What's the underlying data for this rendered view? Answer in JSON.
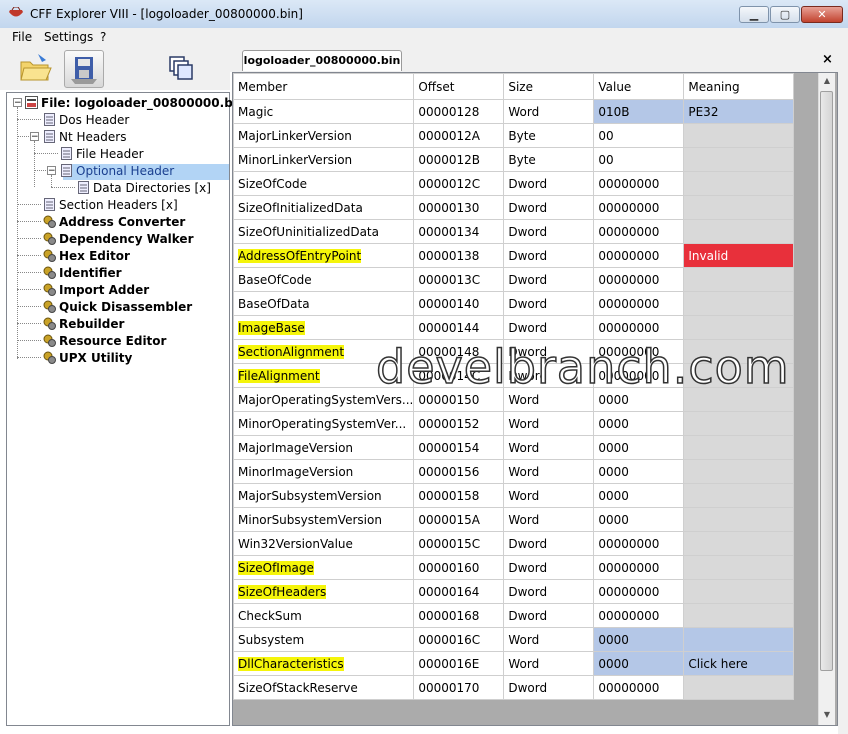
{
  "window": {
    "title": "CFF Explorer VIII - [logoloader_00800000.bin]",
    "min_icon": "minimize-icon",
    "max_icon": "maximize-icon",
    "close_icon": "close-icon",
    "min_glyph": "▁",
    "max_glyph": "▢",
    "close_glyph": "✕"
  },
  "menu": {
    "file": "File",
    "settings": "Settings",
    "help": "?"
  },
  "tree": {
    "root": "File: logoloader_00800000.bin",
    "dos_header": "Dos Header",
    "nt_headers": "Nt Headers",
    "file_header": "File Header",
    "optional_header": "Optional Header",
    "data_directories": "Data Directories [x]",
    "section_headers": "Section Headers [x]",
    "tools": [
      "Address Converter",
      "Dependency Walker",
      "Hex Editor",
      "Identifier",
      "Import Adder",
      "Quick Disassembler",
      "Rebuilder",
      "Resource Editor",
      "UPX Utility"
    ]
  },
  "tab": {
    "label": "logoloader_00800000.bin",
    "close": "×"
  },
  "grid": {
    "columns": [
      "Member",
      "Offset",
      "Size",
      "Value",
      "Meaning"
    ],
    "rows": [
      {
        "member": "Magic",
        "offset": "00000128",
        "size": "Word",
        "value": "010B",
        "meaning": "PE32",
        "style": "blue"
      },
      {
        "member": "MajorLinkerVersion",
        "offset": "0000012A",
        "size": "Byte",
        "value": "00",
        "meaning": ""
      },
      {
        "member": "MinorLinkerVersion",
        "offset": "0000012B",
        "size": "Byte",
        "value": "00",
        "meaning": ""
      },
      {
        "member": "SizeOfCode",
        "offset": "0000012C",
        "size": "Dword",
        "value": "00000000",
        "meaning": ""
      },
      {
        "member": "SizeOfInitializedData",
        "offset": "00000130",
        "size": "Dword",
        "value": "00000000",
        "meaning": ""
      },
      {
        "member": "SizeOfUninitializedData",
        "offset": "00000134",
        "size": "Dword",
        "value": "00000000",
        "meaning": ""
      },
      {
        "member": "AddressOfEntryPoint",
        "offset": "00000138",
        "size": "Dword",
        "value": "00000000",
        "meaning": "Invalid",
        "style": "red",
        "hl": true
      },
      {
        "member": "BaseOfCode",
        "offset": "0000013C",
        "size": "Dword",
        "value": "00000000",
        "meaning": ""
      },
      {
        "member": "BaseOfData",
        "offset": "00000140",
        "size": "Dword",
        "value": "00000000",
        "meaning": ""
      },
      {
        "member": "ImageBase",
        "offset": "00000144",
        "size": "Dword",
        "value": "00000000",
        "meaning": "",
        "hl": true
      },
      {
        "member": "SectionAlignment",
        "offset": "00000148",
        "size": "Dword",
        "value": "00000000",
        "meaning": "",
        "hl": true
      },
      {
        "member": "FileAlignment",
        "offset": "0000014C",
        "size": "Dword",
        "value": "00000000",
        "meaning": "",
        "hl": true
      },
      {
        "member": "MajorOperatingSystemVers...",
        "offset": "00000150",
        "size": "Word",
        "value": "0000",
        "meaning": ""
      },
      {
        "member": "MinorOperatingSystemVer...",
        "offset": "00000152",
        "size": "Word",
        "value": "0000",
        "meaning": ""
      },
      {
        "member": "MajorImageVersion",
        "offset": "00000154",
        "size": "Word",
        "value": "0000",
        "meaning": ""
      },
      {
        "member": "MinorImageVersion",
        "offset": "00000156",
        "size": "Word",
        "value": "0000",
        "meaning": ""
      },
      {
        "member": "MajorSubsystemVersion",
        "offset": "00000158",
        "size": "Word",
        "value": "0000",
        "meaning": ""
      },
      {
        "member": "MinorSubsystemVersion",
        "offset": "0000015A",
        "size": "Word",
        "value": "0000",
        "meaning": ""
      },
      {
        "member": "Win32VersionValue",
        "offset": "0000015C",
        "size": "Dword",
        "value": "00000000",
        "meaning": ""
      },
      {
        "member": "SizeOfImage",
        "offset": "00000160",
        "size": "Dword",
        "value": "00000000",
        "meaning": "",
        "hl": true
      },
      {
        "member": "SizeOfHeaders",
        "offset": "00000164",
        "size": "Dword",
        "value": "00000000",
        "meaning": "",
        "hl": true
      },
      {
        "member": "CheckSum",
        "offset": "00000168",
        "size": "Dword",
        "value": "00000000",
        "meaning": ""
      },
      {
        "member": "Subsystem",
        "offset": "0000016C",
        "size": "Word",
        "value": "0000",
        "meaning": "",
        "style": "blueval"
      },
      {
        "member": "DllCharacteristics",
        "offset": "0000016E",
        "size": "Word",
        "value": "0000",
        "meaning": "Click here",
        "style": "blue",
        "hl": true
      },
      {
        "member": "SizeOfStackReserve",
        "offset": "00000170",
        "size": "Dword",
        "value": "00000000",
        "meaning": ""
      }
    ]
  },
  "watermark": "develbranch.com",
  "colors": {
    "selection": "#b2d4f5",
    "highlight": "#f5f50a",
    "invalid": "#e8303b",
    "info": "#b4c7e7"
  }
}
